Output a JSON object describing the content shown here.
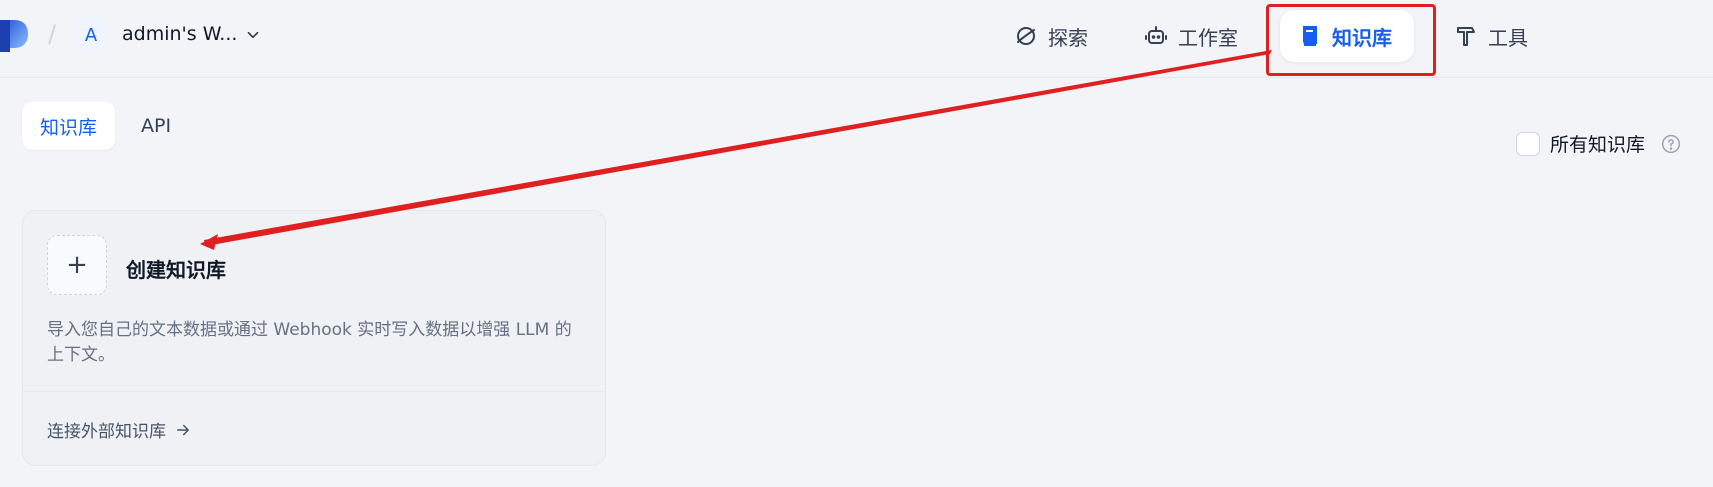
{
  "header": {
    "workspace_initial": "A",
    "workspace_name": "admin's W...",
    "nav": {
      "explore": "探索",
      "studio": "工作室",
      "knowledge": "知识库",
      "tools": "工具"
    }
  },
  "tabs": {
    "knowledge": "知识库",
    "api": "API"
  },
  "filter": {
    "all_knowledge_label": "所有知识库"
  },
  "create_card": {
    "title": "创建知识库",
    "description": "导入您自己的文本数据或通过 Webhook 实时写入数据以增强 LLM 的上下文。",
    "connect_external": "连接外部知识库"
  },
  "colors": {
    "accent": "#155eef",
    "annotation": "#e02020",
    "background": "#f3f4f8"
  }
}
